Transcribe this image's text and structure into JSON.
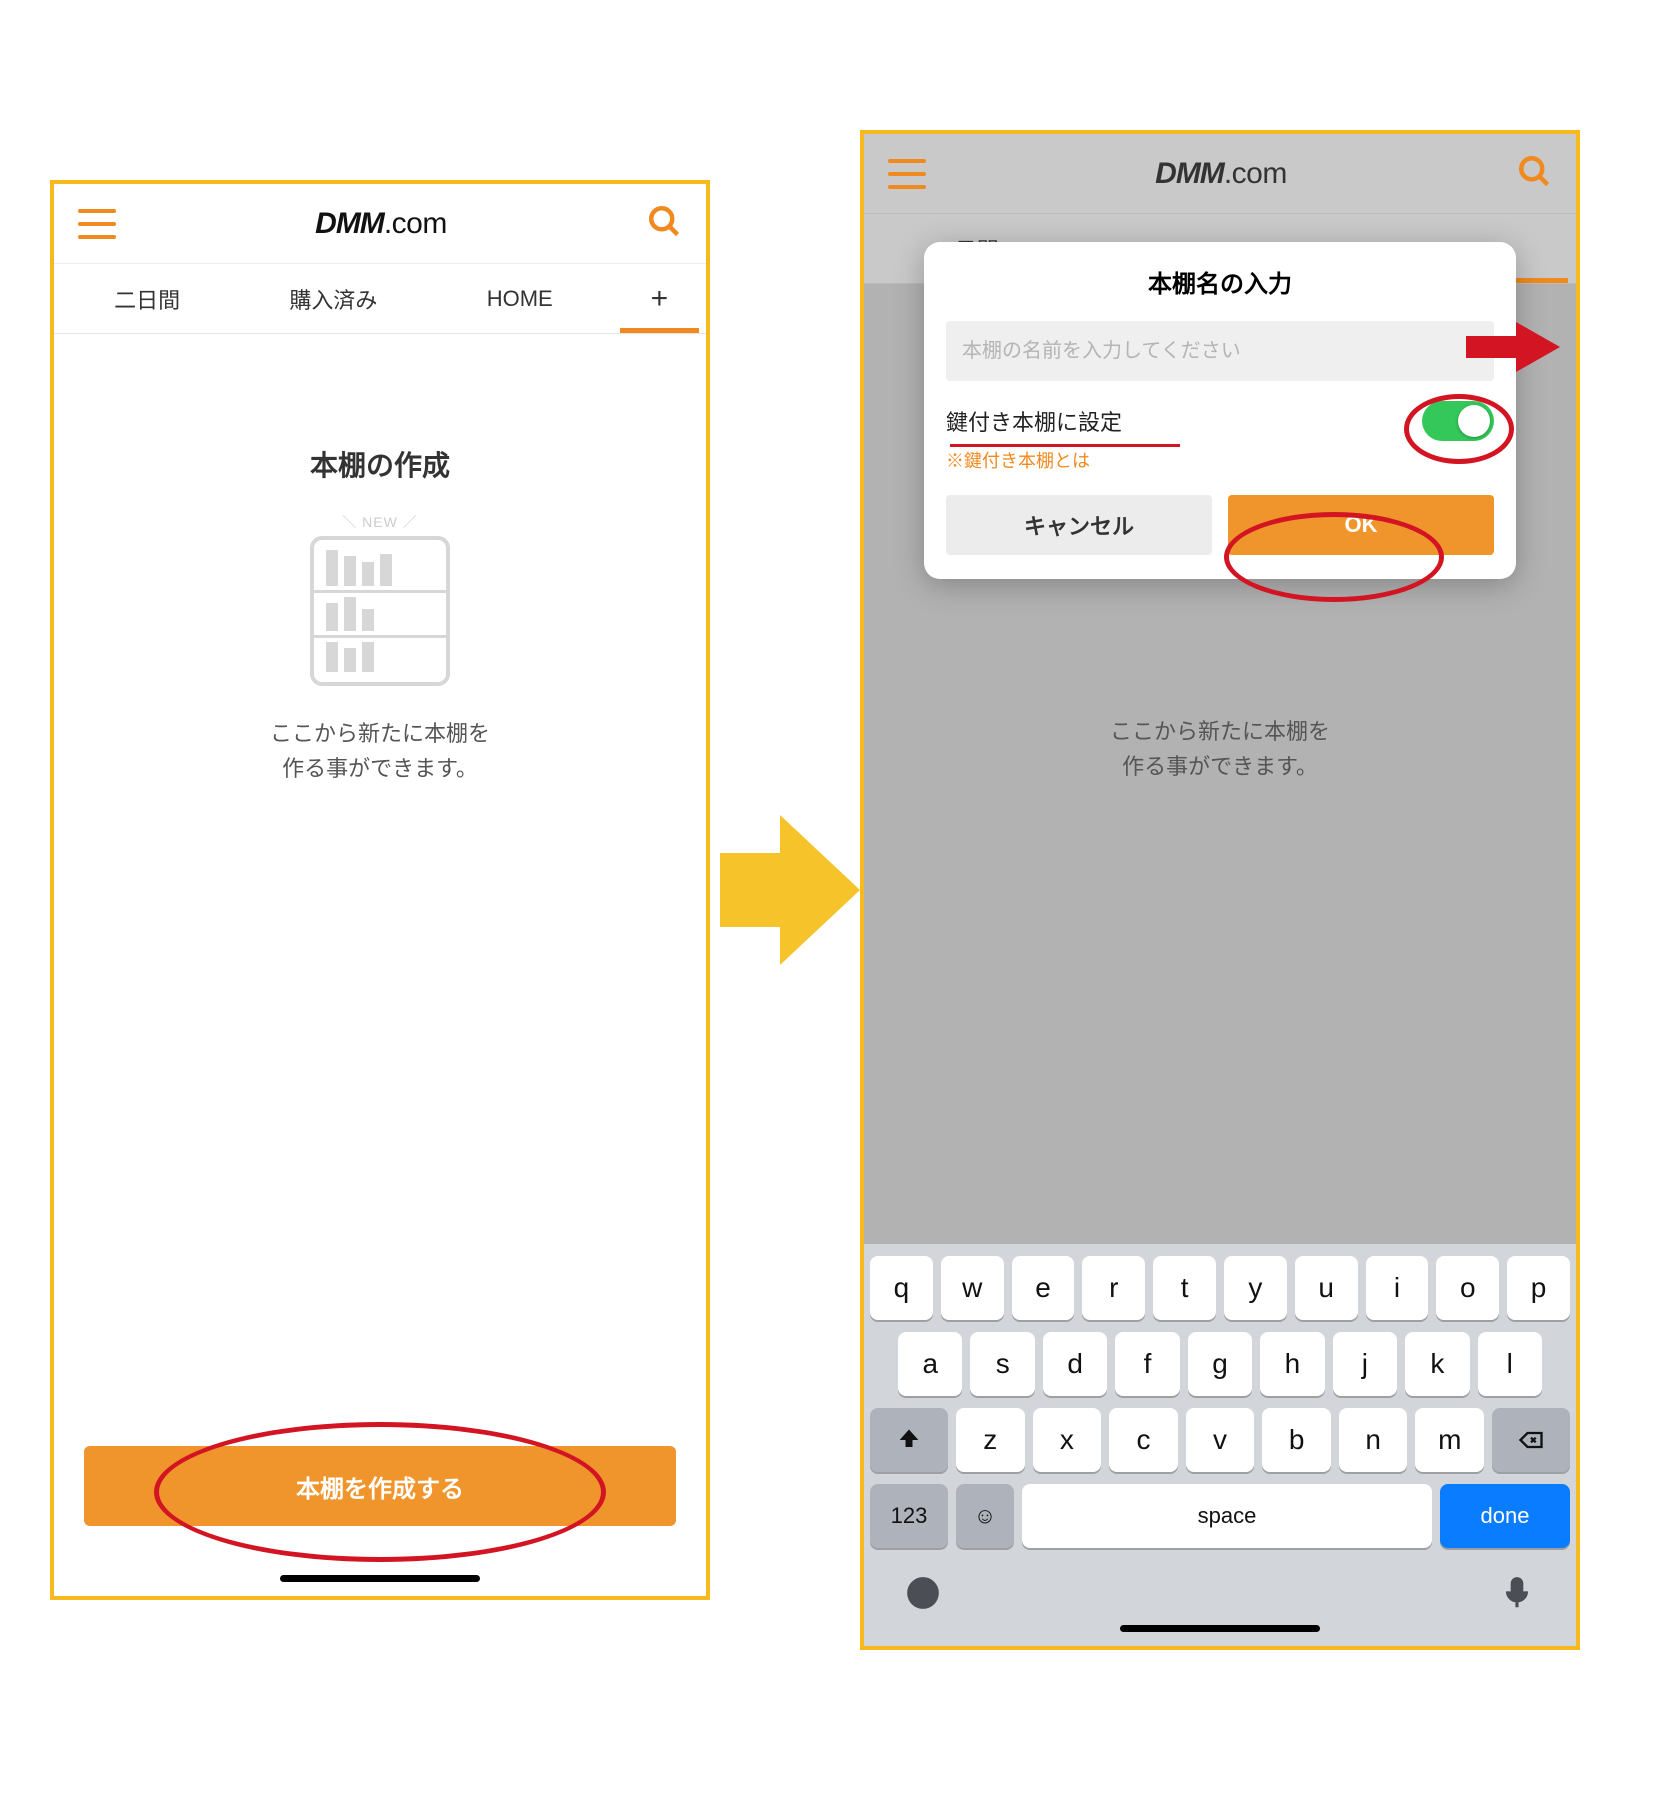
{
  "brand": {
    "bold": "DMM",
    "rest": ".com"
  },
  "left": {
    "tabs": [
      "二日間",
      "購入済み",
      "HOME",
      "+"
    ],
    "title": "本棚の作成",
    "shelf_new": "＼ NEW ／",
    "desc_l1": "ここから新たに本棚を",
    "desc_l2": "作る事ができます。",
    "create_button": "本棚を作成する"
  },
  "right": {
    "tab_visible": "二日間",
    "desc_l1": "ここから新たに本棚を",
    "desc_l2": "作る事ができます。",
    "dialog": {
      "title": "本棚名の入力",
      "placeholder": "本棚の名前を入力してください",
      "lock_label": "鍵付き本棚に設定",
      "lock_note": "※鍵付き本棚とは",
      "toggle_on": true,
      "cancel": "キャンセル",
      "ok": "OK"
    },
    "keyboard": {
      "row1": [
        "q",
        "w",
        "e",
        "r",
        "t",
        "y",
        "u",
        "i",
        "o",
        "p"
      ],
      "row2": [
        "a",
        "s",
        "d",
        "f",
        "g",
        "h",
        "j",
        "k",
        "l"
      ],
      "row3": [
        "z",
        "x",
        "c",
        "v",
        "b",
        "n",
        "m"
      ],
      "k123": "123",
      "space": "space",
      "done": "done"
    }
  }
}
